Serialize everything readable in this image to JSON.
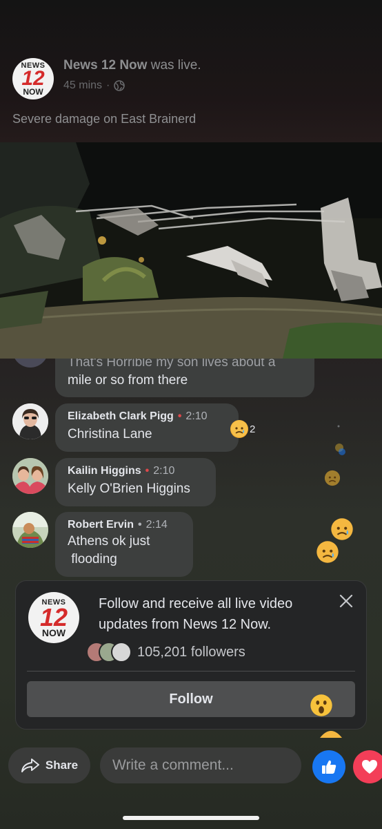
{
  "post": {
    "logo_top": "NEWS",
    "logo_num": "12",
    "logo_bottom": "NOW",
    "page_name": "News 12 Now",
    "live_suffix": " was live.",
    "time_ago": "45 mins",
    "separator": "·",
    "text": "Severe damage on East Brainerd"
  },
  "comments": [
    {
      "name": "",
      "time": "",
      "text_line1": "That's Horrible my son lives about a",
      "text_line2": "mile or so from there"
    },
    {
      "name": "Elizabeth Clark Pigg",
      "time": "2:10",
      "text": "Christina Lane",
      "reaction_count": "2"
    },
    {
      "name": "Kailin Higgins",
      "time": "2:10",
      "text": "Kelly O'Brien Higgins"
    },
    {
      "name": "Robert Ervin",
      "time": "2:14",
      "text_line1": "Athens ok just",
      "text_line2": " flooding"
    }
  ],
  "follow_card": {
    "text": "Follow and receive all live video updates from News 12 Now.",
    "followers": "105,201 followers",
    "button": "Follow"
  },
  "bottom_bar": {
    "share": "Share",
    "comment_placeholder": "Write a comment..."
  },
  "colors": {
    "like_blue": "#1877f2",
    "love_red": "#f33e58",
    "live_dot_red": "#e0484b"
  },
  "icons": [
    "globe-icon",
    "close-icon",
    "share-arrow-icon",
    "thumbs-up-icon",
    "heart-icon",
    "sad-emoji-icon",
    "wow-emoji-icon"
  ]
}
